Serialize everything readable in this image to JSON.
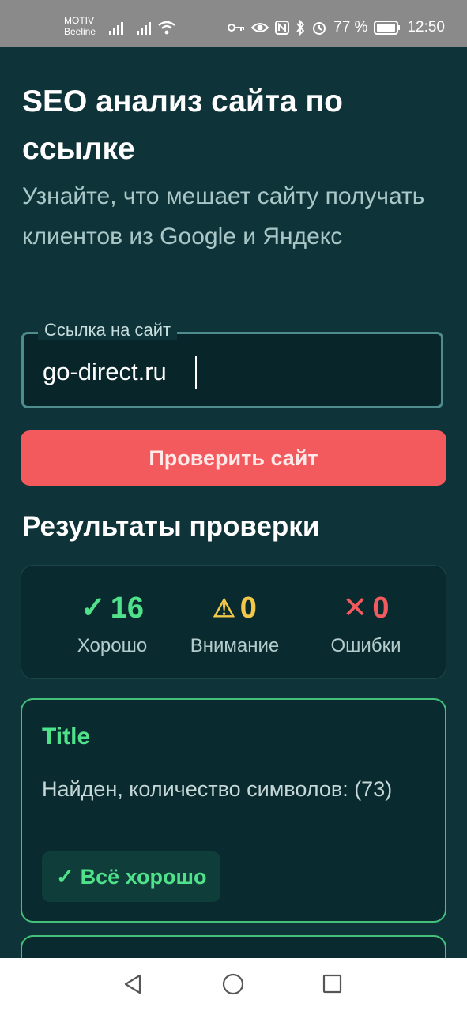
{
  "status_bar": {
    "carrier_top": "MOTIV",
    "carrier_bottom": "Beeline",
    "battery": "77 %",
    "time": "12:50"
  },
  "page": {
    "title": "SEO анализ сайта по ссылке",
    "subtitle": "Узнайте, что мешает сайту получать клиентов из Google и Яндекс"
  },
  "form": {
    "url_label": "Ссылка на сайт",
    "url_value": "go-direct.ru",
    "submit_label": "Проверить сайт"
  },
  "results": {
    "heading": "Результаты проверки",
    "summary": [
      {
        "icon": "check-icon",
        "symbol": "✓",
        "count": "16",
        "label": "Хорошо",
        "color": "#4fe28a"
      },
      {
        "icon": "warning-icon",
        "symbol": "⚠",
        "count": "0",
        "label": "Внимание",
        "color": "#f2c84b"
      },
      {
        "icon": "cross-icon",
        "symbol": "✕",
        "count": "0",
        "label": "Ошибки",
        "color": "#f25a5e"
      }
    ],
    "card": {
      "title": "Title",
      "description": "Найден, количество символов: (73)",
      "badge_symbol": "✓",
      "badge_label": "Всё хорошо"
    }
  },
  "colors": {
    "background": "#0e3338",
    "accent_red": "#f25a5e",
    "good_green": "#4fe28a",
    "warning_yellow": "#f2c84b"
  }
}
